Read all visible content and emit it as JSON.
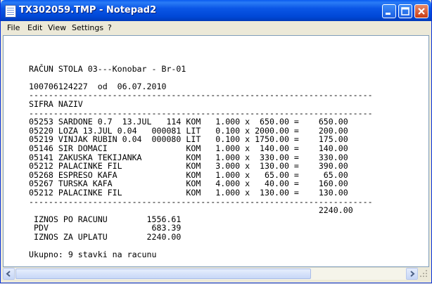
{
  "window": {
    "title": "TX302059.TMP - Notepad2"
  },
  "menu": [
    "File",
    "Edit",
    "View",
    "Settings",
    "?"
  ],
  "document": {
    "lines": [
      "",
      "RAČUN STOLA 03---Konobar - Br-01",
      "",
      "100706124227  od  06.07.2010",
      "----------------------------------------------------------------------",
      "SIFRA NAZIV",
      "----------------------------------------------------------------------",
      "05253 SARDONE 0.7  13.JUL   114 KOM   1.000 x  650.00 =    650.00",
      "05220 LOZA 13.JUL 0.04   000081 LIT   0.100 x 2000.00 =    200.00",
      "05219 VINJAK RUBIN 0.04  000080 LIT   0.100 x 1750.00 =    175.00",
      "05146 SIR DOMACI                KOM   1.000 x  140.00 =    140.00",
      "05141 ZAKUSKA TEKIJANKA         KOM   1.000 x  330.00 =    330.00",
      "05212 PALACINKE FIL             KOM   3.000 x  130.00 =    390.00",
      "05268 ESPRESO KAFA              KOM   1.000 x   65.00 =     65.00",
      "05267 TURSKA KAFA               KOM   4.000 x   40.00 =    160.00",
      "05212 PALACINKE FIL             KOM   1.000 x  130.00 =    130.00",
      "----------------------------------------------------------------------",
      "                                                           2240.00",
      " IZNOS PO RACUNU        1556.61",
      " PDV                     683.39",
      " IZNOS ZA UPLATU        2240.00",
      "",
      "Ukupno: 9 stavki na racunu"
    ]
  }
}
